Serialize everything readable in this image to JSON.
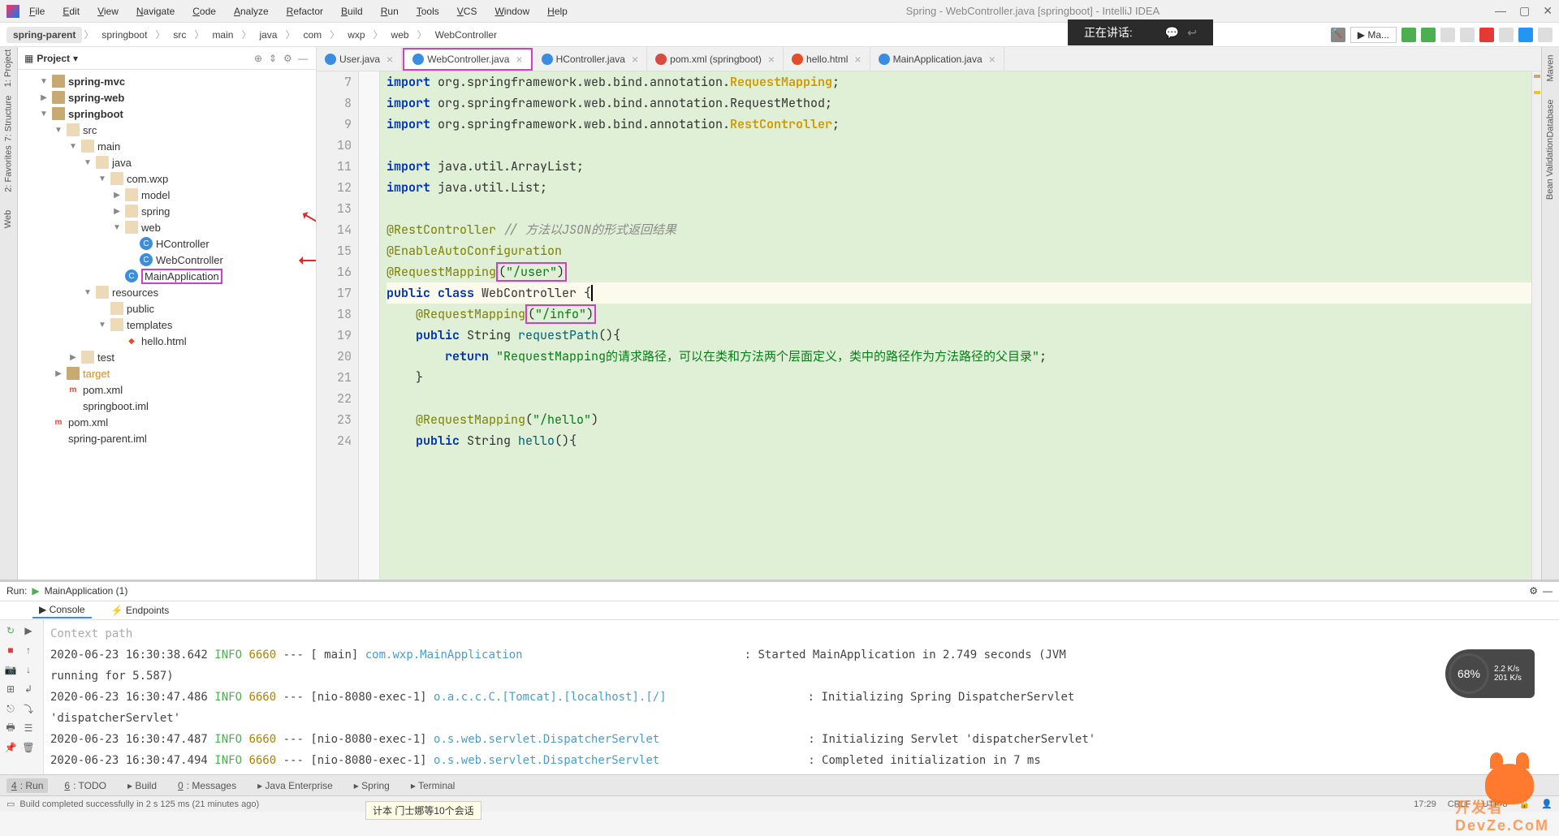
{
  "window": {
    "title": "Spring - WebController.java [springboot] - IntelliJ IDEA"
  },
  "menu": [
    "File",
    "Edit",
    "View",
    "Navigate",
    "Code",
    "Analyze",
    "Refactor",
    "Build",
    "Run",
    "Tools",
    "VCS",
    "Window",
    "Help"
  ],
  "breadcrumb": [
    "spring-parent",
    "springboot",
    "src",
    "main",
    "java",
    "com",
    "wxp",
    "web",
    "WebController"
  ],
  "toolbar_config": "Ma...",
  "notification": {
    "text": "正在讲话:"
  },
  "project": {
    "title": "Project",
    "tree": [
      {
        "indent": 1,
        "caret": "▼",
        "icon": "folder",
        "label": "spring-mvc",
        "bold": true
      },
      {
        "indent": 1,
        "caret": "▶",
        "icon": "folder",
        "label": "spring-web",
        "bold": true
      },
      {
        "indent": 1,
        "caret": "▼",
        "icon": "folder",
        "label": "springboot",
        "bold": true
      },
      {
        "indent": 2,
        "caret": "▼",
        "icon": "folder-o",
        "label": "src"
      },
      {
        "indent": 3,
        "caret": "▼",
        "icon": "folder-o",
        "label": "main"
      },
      {
        "indent": 4,
        "caret": "▼",
        "icon": "folder-o",
        "label": "java"
      },
      {
        "indent": 5,
        "caret": "▼",
        "icon": "folder-o",
        "label": "com.wxp"
      },
      {
        "indent": 6,
        "caret": "▶",
        "icon": "folder-o",
        "label": "model"
      },
      {
        "indent": 6,
        "caret": "▶",
        "icon": "folder-o",
        "label": "spring"
      },
      {
        "indent": 6,
        "caret": "▼",
        "icon": "folder-o",
        "label": "web",
        "arrow": true
      },
      {
        "indent": 7,
        "caret": "",
        "icon": "class",
        "label": "HController"
      },
      {
        "indent": 7,
        "caret": "",
        "icon": "class",
        "label": "WebController",
        "arrow": true
      },
      {
        "indent": 6,
        "caret": "",
        "icon": "class",
        "label": "MainApplication",
        "highlight": true
      },
      {
        "indent": 4,
        "caret": "▼",
        "icon": "folder-o",
        "label": "resources"
      },
      {
        "indent": 5,
        "caret": "",
        "icon": "folder-o",
        "label": "public"
      },
      {
        "indent": 5,
        "caret": "▼",
        "icon": "folder-o",
        "label": "templates"
      },
      {
        "indent": 6,
        "caret": "",
        "icon": "html",
        "label": "hello.html"
      },
      {
        "indent": 3,
        "caret": "▶",
        "icon": "folder-o",
        "label": "test"
      },
      {
        "indent": 2,
        "caret": "▶",
        "icon": "folder",
        "label": "target",
        "color": "#d28b26"
      },
      {
        "indent": 2,
        "caret": "",
        "icon": "mvn",
        "label": "pom.xml"
      },
      {
        "indent": 2,
        "caret": "",
        "icon": "file",
        "label": "springboot.iml"
      },
      {
        "indent": 1,
        "caret": "",
        "icon": "mvn",
        "label": "pom.xml"
      },
      {
        "indent": 1,
        "caret": "",
        "icon": "file",
        "label": "spring-parent.iml"
      }
    ]
  },
  "tabs": [
    {
      "icon": "java",
      "label": "User.java",
      "active": false
    },
    {
      "icon": "java",
      "label": "WebController.java",
      "active": true,
      "highlight": true
    },
    {
      "icon": "java",
      "label": "HController.java",
      "active": false
    },
    {
      "icon": "xml",
      "label": "pom.xml (springboot)",
      "active": false
    },
    {
      "icon": "html",
      "label": "hello.html",
      "active": false
    },
    {
      "icon": "java",
      "label": "MainApplication.java",
      "active": false
    }
  ],
  "code": {
    "line_start": 7,
    "lines": [
      {
        "n": 7,
        "html": "<span class='kw'>import</span> org.springframework.web.bind.annotation.<span class='cls'>RequestMapping</span>;"
      },
      {
        "n": 8,
        "html": "<span class='kw'>import</span> org.springframework.web.bind.annotation.RequestMethod;"
      },
      {
        "n": 9,
        "html": "<span class='kw'>import</span> org.springframework.web.bind.annotation.<span class='cls'>RestController</span>;"
      },
      {
        "n": 10,
        "html": ""
      },
      {
        "n": 11,
        "html": "<span class='kw'>import</span> java.util.ArrayList;"
      },
      {
        "n": 12,
        "html": "<span class='kw'>import</span> java.util.List;"
      },
      {
        "n": 13,
        "html": ""
      },
      {
        "n": 14,
        "html": "<span class='ann-yellow'>@RestController</span> <span class='cmt'>// 方法以JSON的形式返回结果</span>"
      },
      {
        "n": 15,
        "html": "<span class='ann-yellow'>@EnableAutoConfiguration</span>"
      },
      {
        "n": 16,
        "html": "<span class='ann-yellow'>@RequestMapping</span><span class='inline-hl'>(<span class='str'>\"/user\"</span>)</span>"
      },
      {
        "n": 17,
        "html": "<span class='kw'>public class</span> WebController <span class='cursor'>{</span>",
        "current": true
      },
      {
        "n": 18,
        "html": "    <span class='ann-yellow'>@RequestMapping</span><span class='inline-hl'>(<span class='str'>\"/info\"</span>)</span>"
      },
      {
        "n": 19,
        "html": "    <span class='kw'>public</span> String <span class='meth'>requestPath</span>(){"
      },
      {
        "n": 20,
        "html": "        <span class='kw'>return</span> <span class='str'>\"RequestMapping的请求路径，可以在类和方法两个层面定义，类中的路径作为方法路径的父目录\"</span>;"
      },
      {
        "n": 21,
        "html": "    }"
      },
      {
        "n": 22,
        "html": ""
      },
      {
        "n": 23,
        "html": "    <span class='ann-yellow'>@RequestMapping</span>(<span class='str'>\"/hello\"</span>)"
      },
      {
        "n": 24,
        "html": "    <span class='kw'>public</span> String <span class='meth'>hello</span>(){"
      }
    ]
  },
  "run": {
    "label": "Run:",
    "config": "MainApplication (1)",
    "tabs": [
      "Console",
      "Endpoints"
    ],
    "prelude": "    Context path",
    "logs": [
      {
        "ts": "2020-06-23 16:30:38.642",
        "lvl": "INFO",
        "pid": "6660",
        "thread": "[           main]",
        "logger": "com.wxp.MainApplication",
        "msg": ": Started MainApplication in 2.749 seconds (JVM",
        "cont": "running for 5.587)"
      },
      {
        "ts": "2020-06-23 16:30:47.486",
        "lvl": "INFO",
        "pid": "6660",
        "thread": "[nio-8080-exec-1]",
        "logger": "o.a.c.c.C.[Tomcat].[localhost].[/]",
        "msg": ": Initializing Spring DispatcherServlet",
        "cont": "'dispatcherServlet'"
      },
      {
        "ts": "2020-06-23 16:30:47.487",
        "lvl": "INFO",
        "pid": "6660",
        "thread": "[nio-8080-exec-1]",
        "logger": "o.s.web.servlet.DispatcherServlet",
        "msg": ": Initializing Servlet 'dispatcherServlet'"
      },
      {
        "ts": "2020-06-23 16:30:47.494",
        "lvl": "INFO",
        "pid": "6660",
        "thread": "[nio-8080-exec-1]",
        "logger": "o.s.web.servlet.DispatcherServlet",
        "msg": ": Completed initialization in 7 ms"
      }
    ]
  },
  "bottom_tabs": [
    {
      "key": "4",
      "label": "Run",
      "active": true
    },
    {
      "key": "6",
      "label": "TODO"
    },
    {
      "key": "",
      "label": "Build"
    },
    {
      "key": "0",
      "label": "Messages"
    },
    {
      "key": "",
      "label": "Java Enterprise"
    },
    {
      "key": "",
      "label": "Spring"
    },
    {
      "key": "",
      "label": "Terminal"
    }
  ],
  "status": {
    "msg": "Build completed successfully in 2 s 125 ms (21 minutes ago)",
    "pos": "17:29",
    "eol": "CRLF",
    "enc": "UTF-8"
  },
  "tooltip": "计本 门士娜等10个会话",
  "left_rail": [
    "1: Project",
    "7: Structure",
    "2: Favorites",
    "Web"
  ],
  "right_rail": [
    "Maven",
    "Database",
    "Bean Validation"
  ],
  "perf": {
    "pct": "68%",
    "up": "2.2 K/s",
    "down": "201 K/s"
  },
  "watermark": "DevZe.CoM"
}
